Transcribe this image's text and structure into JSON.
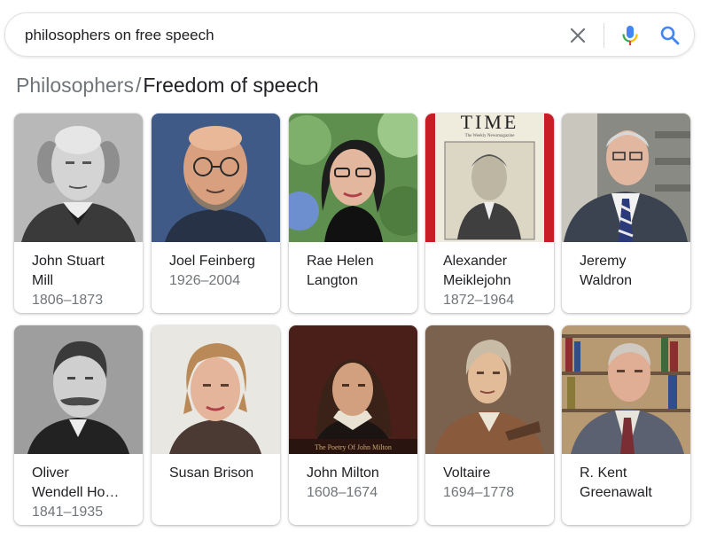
{
  "search": {
    "query": "philosophers on free speech",
    "clear_icon": "close-icon",
    "voice_icon": "mic-icon",
    "search_icon": "search-icon"
  },
  "breadcrumb": {
    "parent": "Philosophers",
    "separator": "/",
    "current": "Freedom of speech"
  },
  "colors": {
    "google_blue": "#4285f4",
    "google_red": "#ea4335",
    "google_yellow": "#fbbc05",
    "google_green": "#34a853",
    "secondary_text": "#70757a"
  },
  "people": [
    {
      "name_lines": [
        "John Stuart",
        "Mill"
      ],
      "years": "1806–1873"
    },
    {
      "name_lines": [
        "Joel Feinberg"
      ],
      "years": "1926–2004"
    },
    {
      "name_lines": [
        "Rae Helen",
        "Langton"
      ],
      "years": ""
    },
    {
      "name_lines": [
        "Alexander",
        "Meiklejohn"
      ],
      "years": "1872–1964",
      "photo_text": [
        "TIME",
        "The Weekly Newsmagazine"
      ]
    },
    {
      "name_lines": [
        "Jeremy",
        "Waldron"
      ],
      "years": ""
    },
    {
      "name_lines": [
        "Oliver",
        "Wendell Ho…"
      ],
      "years": "1841–1935"
    },
    {
      "name_lines": [
        "Susan Brison"
      ],
      "years": ""
    },
    {
      "name_lines": [
        "John Milton"
      ],
      "years": "1608–1674",
      "photo_text": [
        "The Poetry Of John Milton"
      ]
    },
    {
      "name_lines": [
        "Voltaire"
      ],
      "years": "1694–1778"
    },
    {
      "name_lines": [
        "R. Kent",
        "Greenawalt"
      ],
      "years": ""
    }
  ]
}
